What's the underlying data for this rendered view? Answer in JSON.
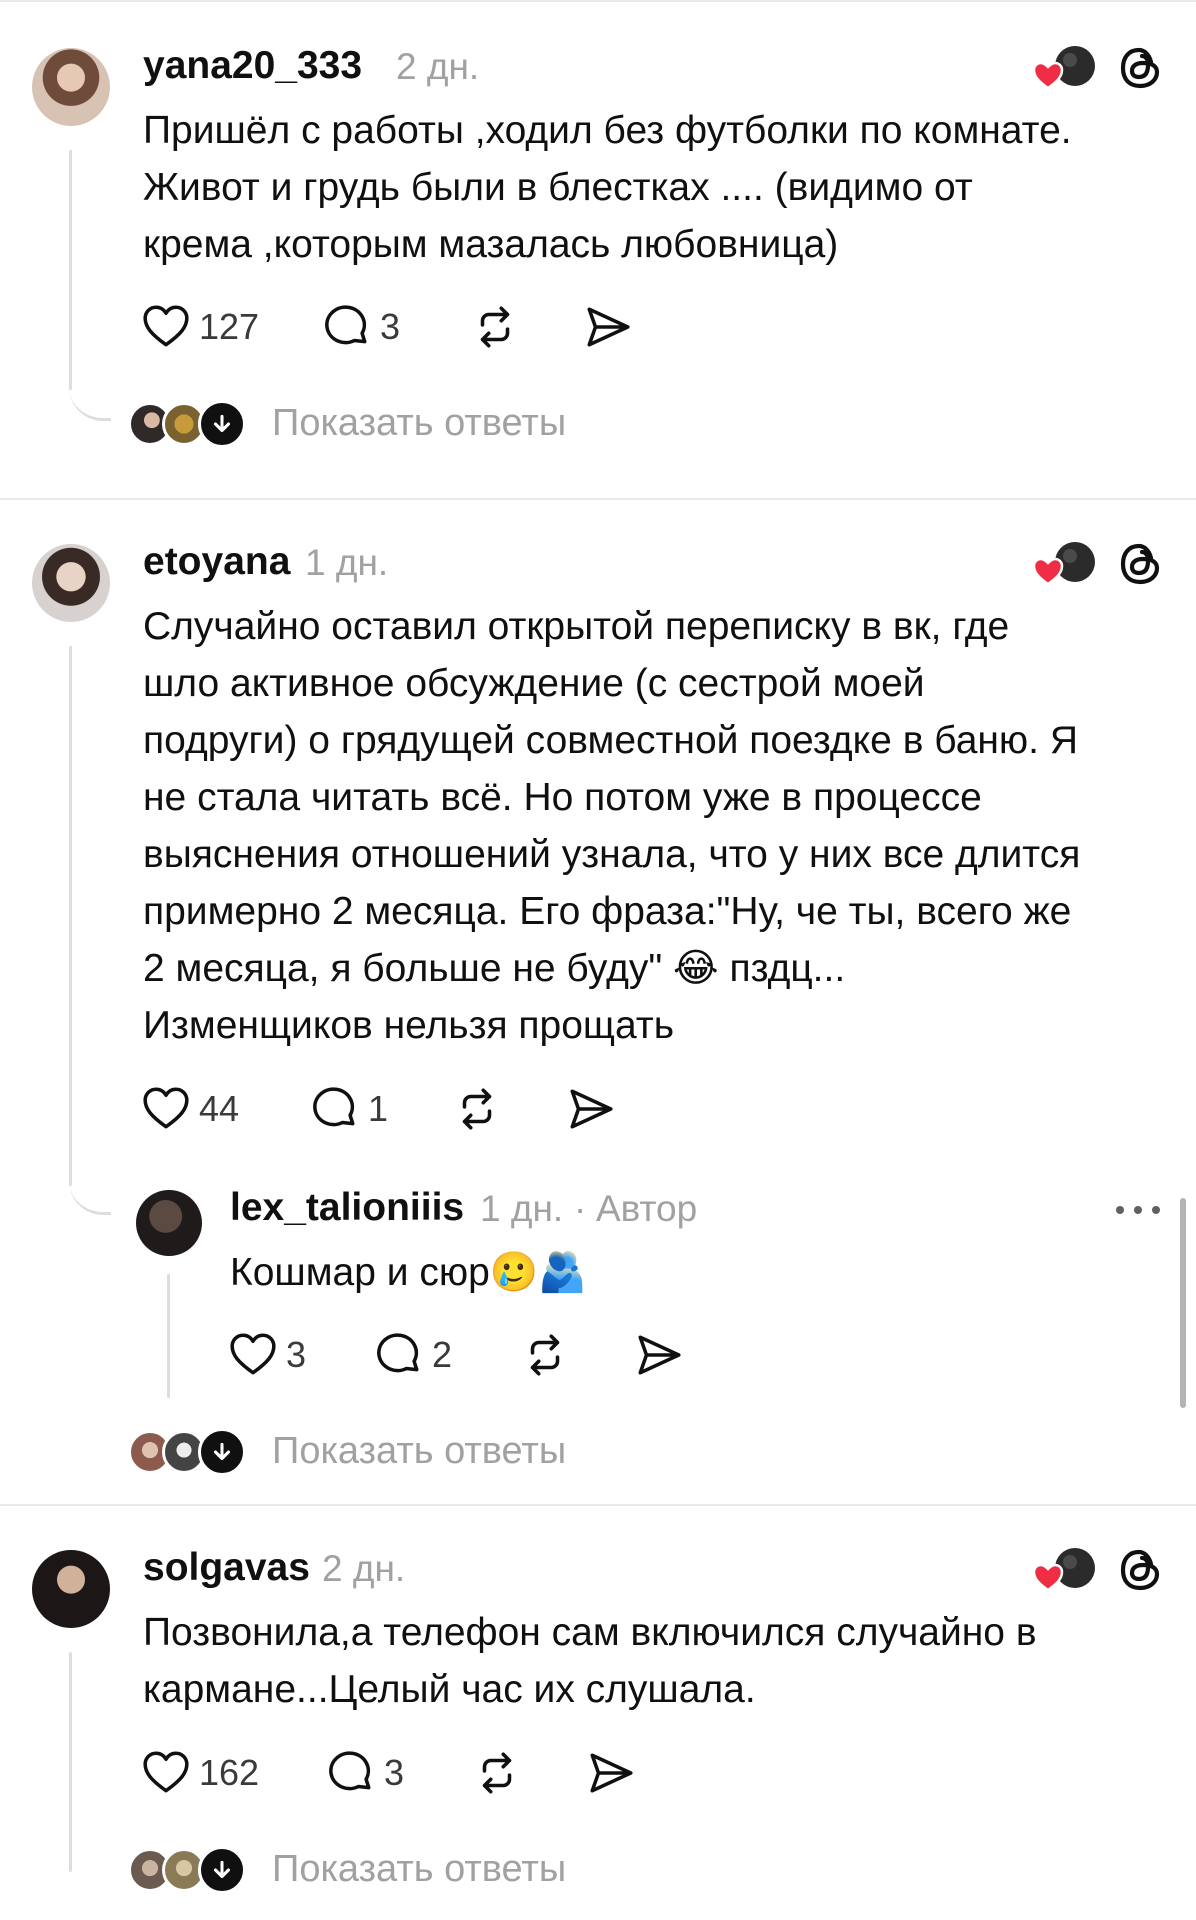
{
  "colors": {
    "text": "#101010",
    "secondary": "#a1a1a1",
    "divider": "#e9e9e9",
    "line": "#dddddd",
    "like_red": "#ef2e46"
  },
  "comments": [
    {
      "username": "yana20_333",
      "time": "2 дн.",
      "text_lines": [
        "Пришёл с работы ,ходил без футболки по комнате.",
        "Живот и грудь были в блестках .... (видимо от",
        "крема ,которым мазалась любовница)"
      ],
      "likes": "127",
      "replies": "3",
      "show_replies": "Показать ответы"
    },
    {
      "username": "etoyana",
      "time": "1 дн.",
      "text_lines": [
        "Случайно оставил открытой переписку в вк, где",
        "шло активное обсуждение (с сестрой моей",
        "подруги) о грядущей совместной поездке в баню. Я",
        "не стала читать всё. Но потом уже в процессе",
        "выяснения отношений узнала, что у них все длится",
        "примерно 2 месяца. Его фраза:\"Ну, че ты, всего же",
        "2 месяца, я больше не буду\" 😂 пздц...",
        "Изменщиков нельзя прощать"
      ],
      "likes": "44",
      "replies": "1",
      "show_replies": "Показать ответы",
      "reply": {
        "username": "lex_talioniiis",
        "time": "1 дн.",
        "separator": "·",
        "author_badge": "Автор",
        "text": "Кошмар и сюр🥲🫂",
        "likes": "3",
        "replies": "2"
      }
    },
    {
      "username": "solgavas",
      "time": "2 дн.",
      "text_lines": [
        "Позвонила,а телефон сам включился случайно в",
        "кармане...Целый час их слушала."
      ],
      "likes": "162",
      "replies": "3",
      "show_replies": "Показать ответы"
    }
  ],
  "icons": {
    "like": "heart-outline-icon",
    "reply": "speech-bubble-icon",
    "repost": "repost-icon",
    "share": "send-icon",
    "liked_by_author": "liked-by-author-icon",
    "threads": "threads-logo-icon",
    "more": "more-dots-icon",
    "expand": "arrow-down-icon"
  }
}
